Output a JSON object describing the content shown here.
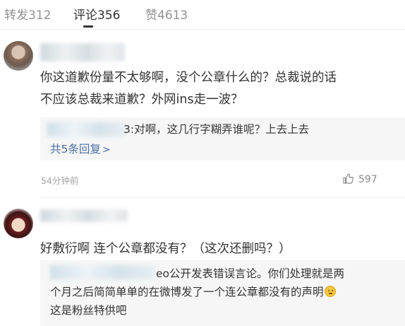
{
  "tabs": [
    {
      "label": "转发312"
    },
    {
      "label": "评论356"
    },
    {
      "label": "赞4613"
    }
  ],
  "comments": [
    {
      "lines": [
        "你这道歉份量不太够啊，没个公章什么的？总裁说的话",
        "不应该总裁来道歉？外网ins走一波？"
      ],
      "reply_preview": "3:对啊，这几行字糊弄谁呢？上去上去",
      "more_replies": "共5条回复",
      "timestamp": "54分钟前",
      "likes": "597"
    },
    {
      "lines": [
        "好敷衍啊 连个公章都没有？（这次还删吗？）"
      ],
      "reply_lines": [
        "eo公开发表错误言论。你们处理就是两",
        "个月之后简简单单的在微博发了一个连公章都没有的声明",
        "这是粉丝特供吧"
      ]
    }
  ],
  "icons": {
    "like": "thumbs-up-icon",
    "emoji": "smirk-emoji-icon",
    "more": "chevron-right-icon"
  },
  "colors": {
    "link": "#4a6fa5",
    "muted": "#a3a3a3",
    "reply_bg": "#f6f6f6"
  }
}
